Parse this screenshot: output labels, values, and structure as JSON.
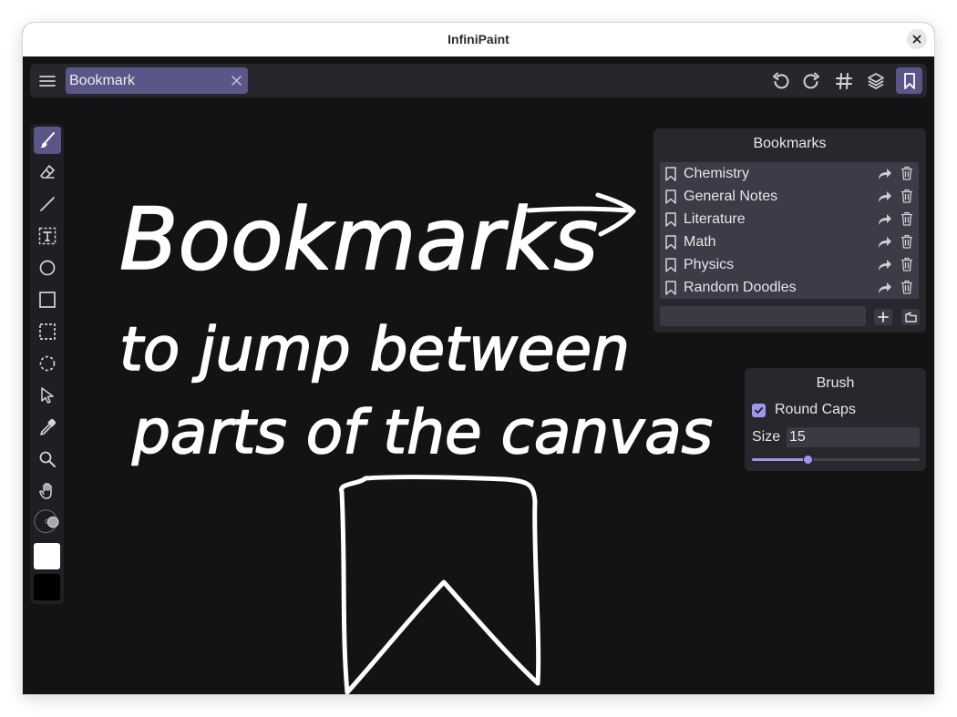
{
  "window": {
    "title": "InfiniPaint"
  },
  "toolbar": {
    "tab_label": "Bookmark",
    "right_buttons": [
      "undo-icon",
      "redo-icon",
      "grid-icon",
      "layers-icon",
      "bookmark-icon"
    ]
  },
  "tools": [
    "paintbrush-icon",
    "eraser-icon",
    "line-icon",
    "text-icon",
    "ellipse-icon",
    "rectangle-icon",
    "rect-select-icon",
    "lasso-select-icon",
    "cursor-icon",
    "eyedropper-icon",
    "zoom-icon",
    "hand-icon",
    "brush-preview-icon"
  ],
  "colors": {
    "accent": "#9d98e8",
    "tab_active": "#5a5788",
    "canvas_bg": "#131313",
    "foreground_color": "#ffffff",
    "background_color": "#000000"
  },
  "canvas_annotation": {
    "line1": "Bookmarks",
    "line2": "to jump between",
    "line3": "parts of the canvas"
  },
  "bookmarks": {
    "title": "Bookmarks",
    "items": [
      "Chemistry",
      "General Notes",
      "Literature",
      "Math",
      "Physics",
      "Random Doodles"
    ],
    "new_name_value": ""
  },
  "brush": {
    "title": "Brush",
    "round_caps_label": "Round Caps",
    "round_caps_checked": true,
    "size_label": "Size",
    "size_value": "15",
    "size_slider_fraction": 0.33
  }
}
